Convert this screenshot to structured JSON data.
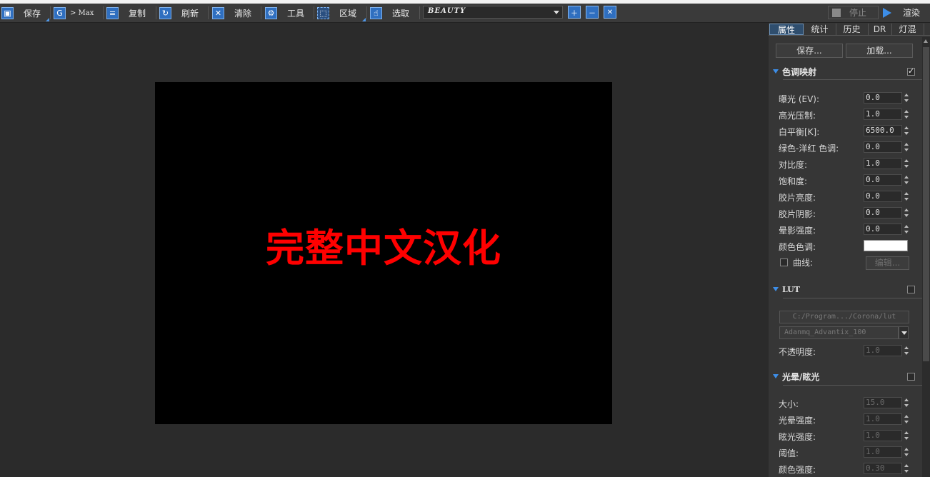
{
  "toolbar": {
    "save": "保存",
    "max": "> Max",
    "copy": "复制",
    "refresh": "刷新",
    "clear": "清除",
    "tools": "工具",
    "region": "区域",
    "pick": "选取",
    "channel": "BEAUTY",
    "stop": "停止",
    "render": "渲染"
  },
  "viewport": {
    "text": "完整中文汉化",
    "text_color": "#ff0000"
  },
  "panel": {
    "tabs": [
      "属性",
      "统计",
      "历史",
      "DR",
      "灯混"
    ],
    "save_button": "保存...",
    "load_button": "加载...",
    "tone_mapping": {
      "title": "色调映射",
      "enabled": true,
      "rows": [
        {
          "label": "曝光 (EV):",
          "value": "0.0"
        },
        {
          "label": "高光压制:",
          "value": "1.0"
        },
        {
          "label": "白平衡[K]:",
          "value": "6500.0"
        },
        {
          "label": "绿色-洋红 色调:",
          "value": "0.0"
        },
        {
          "label": "对比度:",
          "value": "1.0"
        },
        {
          "label": "饱和度:",
          "value": "0.0"
        },
        {
          "label": "胶片亮度:",
          "value": "0.0"
        },
        {
          "label": "胶片阴影:",
          "value": "0.0"
        },
        {
          "label": "晕影强度:",
          "value": "0.0"
        }
      ],
      "color_tint_label": "颜色色调:",
      "color_tint": "#ffffff",
      "curve_label": "曲线:",
      "edit_button": "编辑..."
    },
    "lut": {
      "title": "LUT",
      "path": "C:/Program.../Corona/lut",
      "file": "Adanmq_Advantix_100",
      "opacity_label": "不透明度:",
      "opacity": "1.0"
    },
    "bloom": {
      "title": "光晕/眩光",
      "rows": [
        {
          "label": "大小:",
          "value": "15.0"
        },
        {
          "label": "光晕强度:",
          "value": "1.0"
        },
        {
          "label": "眩光强度:",
          "value": "1.0"
        },
        {
          "label": "阈值:",
          "value": "1.0"
        },
        {
          "label": "颜色强度:",
          "value": "0.30"
        }
      ]
    }
  }
}
